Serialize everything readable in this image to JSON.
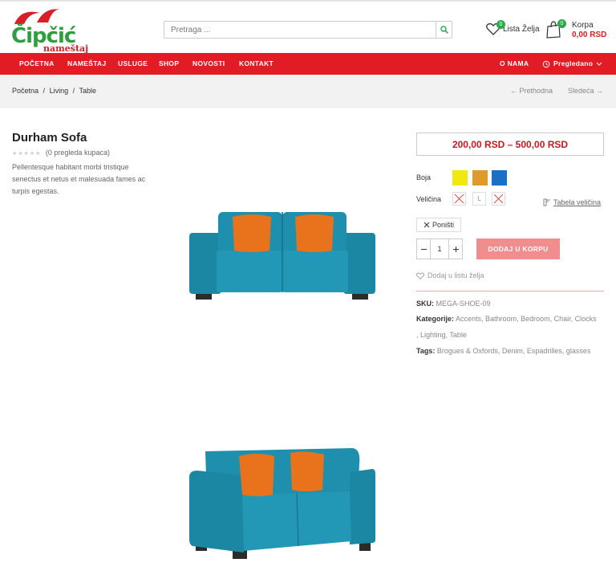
{
  "brand": {
    "name": "Čipčić",
    "tagline": "nameštaj"
  },
  "search": {
    "placeholder": "Pretraga ..."
  },
  "header": {
    "wishlist_label": "Lista Želja",
    "wishlist_count": "0",
    "cart_label": "Korpa",
    "cart_count": "0",
    "cart_total": "0,00 RSD"
  },
  "nav": {
    "items": [
      "POČETNA",
      "NAMEŠTAJ",
      "USLUGE",
      "SHOP",
      "NOVOSTI",
      "KONTAKT"
    ],
    "about": "O NAMA",
    "viewed": "Pregledano"
  },
  "breadcrumb": {
    "items": [
      "Početna",
      "Living",
      "Table"
    ],
    "sep": "/"
  },
  "pager": {
    "prev": "Prethodna",
    "next": "Sledeća"
  },
  "product": {
    "title": "Durham Sofa",
    "reviews": "(0 pregleda kupaca)",
    "description": "Pellentesque habitant morbi tristique senectus et netus et malesuada fames ac turpis egestas.",
    "price": "200,00 RSD – 500,00 RSD",
    "color_label": "Boja",
    "size_label": "Veličina",
    "size_value": "L",
    "size_guide": "Tabela veličina",
    "reset": "Poništi",
    "quantity": "1",
    "add_to_cart": "DODAJ U KORPU",
    "add_to_wishlist": "Dodaj u listu želja",
    "sku_label": "SKU:",
    "sku": "MEGA-SHOE-09",
    "categories_label": "Kategorije:",
    "categories_line1": "Accents, Bathroom, Bedroom, Chair, Clocks",
    "categories_line2": ", Lighting, Table",
    "tags_label": "Tags:",
    "tags": "Brogues & Oxfords, Denim, Espadrilles, glasses"
  },
  "colors": {
    "nav": "#e21c24",
    "price": "#c8181e",
    "add_button": "#f28d8f",
    "swatches": [
      "#f2e80f",
      "#e09a2a",
      "#1c6fc4"
    ],
    "sofa": "#1e8fad",
    "pillow": "#e8731c"
  },
  "icons": [
    "search-icon",
    "heart-icon",
    "bag-icon",
    "history-icon",
    "chevron-down-icon",
    "arrow-left-icon",
    "arrow-right-icon",
    "ruler-icon",
    "close-icon",
    "minus-icon",
    "plus-icon"
  ]
}
